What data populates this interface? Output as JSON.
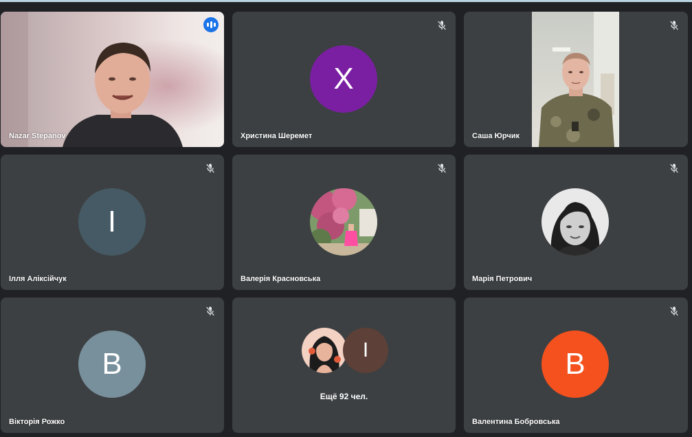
{
  "participants": [
    {
      "name": "Nazar Stepanov",
      "status": "speaking"
    },
    {
      "name": "Христина Шеремет",
      "initial": "Х",
      "avatar_color": "#7b1fa2",
      "status": "muted"
    },
    {
      "name": "Саша Юрчик",
      "status": "muted"
    },
    {
      "name": "Ілля Аліксійчук",
      "initial": "І",
      "avatar_color": "#455a64",
      "status": "muted"
    },
    {
      "name": "Валерія Красновська",
      "status": "muted"
    },
    {
      "name": "Марія Петрович",
      "status": "muted"
    },
    {
      "name": "Вікторія Рожко",
      "initial": "В",
      "avatar_color": "#78909c",
      "status": "muted"
    },
    {
      "more_label": "Ещё 92 чел.",
      "more_initial": "І",
      "more_avatar_color": "#5d4037"
    },
    {
      "name": "Валентина Бобровська",
      "initial": "В",
      "avatar_color": "#f4511e",
      "status": "muted"
    }
  ],
  "icons": {
    "mute": "mic-off-icon",
    "speaking": "audio-level-icon"
  },
  "colors": {
    "background": "#202124",
    "tile": "#3c4043",
    "speaking_border": "#8ab4f8",
    "speaking_indicator": "#1a73e8"
  }
}
